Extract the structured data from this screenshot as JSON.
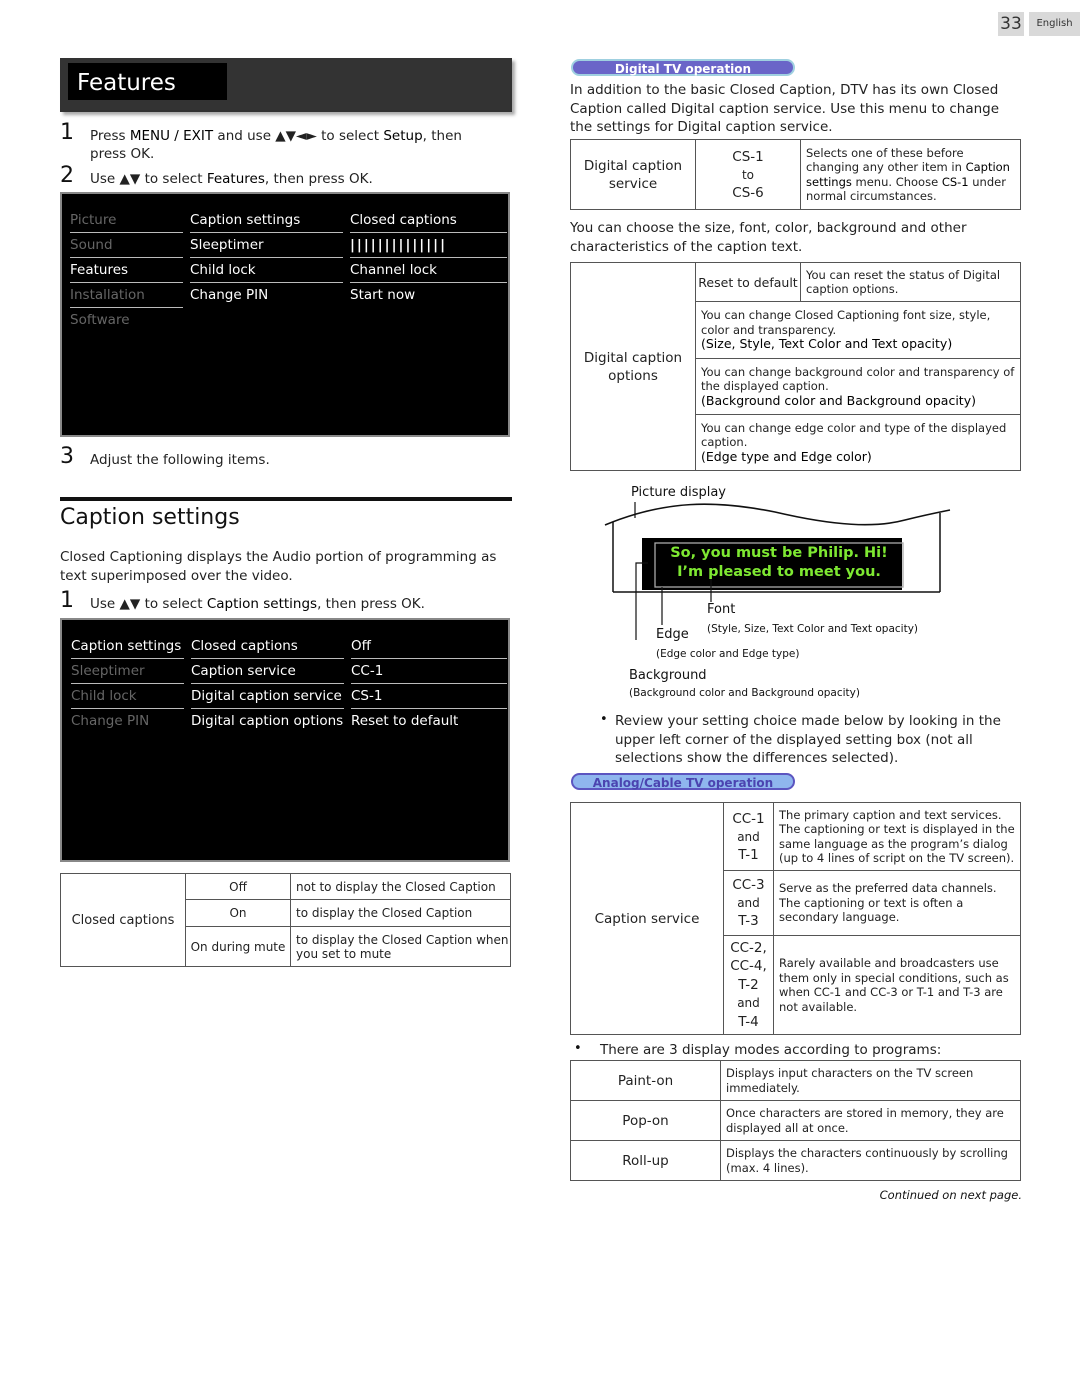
{
  "page": {
    "number": "33",
    "language": "English"
  },
  "left": {
    "banner_title": "Features",
    "steps": [
      {
        "num": "1",
        "pre": "Press ",
        "b1": "MENU / EXIT",
        "mid": " and use ▲▼◄► to select ",
        "b2": "Setup",
        "post": ", then press OK."
      },
      {
        "num": "2",
        "pre": "Use ▲▼ to select ",
        "b1": "Features",
        "post": ", then press OK."
      },
      {
        "num": "3",
        "text": "Adjust the following items."
      }
    ],
    "menu1": {
      "col1": [
        "Picture",
        "Sound",
        "Features",
        "Installation",
        "Software"
      ],
      "col1_active_index": 2,
      "col2": [
        "Caption settings",
        "Sleeptimer",
        "Child lock",
        "Change PIN"
      ],
      "col3": [
        "Closed captions",
        "||||||||||||||",
        "Channel lock",
        "Start now"
      ]
    },
    "section_title": "Caption settings",
    "section_intro": "Closed Captioning displays the Audio portion of programming as text superimposed over the video.",
    "section_step": {
      "num": "1",
      "pre": "Use ▲▼ to select ",
      "b1": "Caption settings",
      "post": ", then press OK."
    },
    "menu2": {
      "col1": [
        "Caption settings",
        "Sleeptimer",
        "Child lock",
        "Change PIN"
      ],
      "col2": [
        "Closed captions",
        "Caption service",
        "Digital caption service",
        "Digital caption options"
      ],
      "col3": [
        "Off",
        "CC-1",
        "CS-1",
        "Reset to default"
      ]
    },
    "cc_table": {
      "label": "Closed captions",
      "rows": [
        {
          "option": "Off",
          "desc": "not to display the Closed Caption"
        },
        {
          "option": "On",
          "desc": "to display the Closed Caption"
        },
        {
          "option": "On during mute",
          "desc": "to display the Closed Caption when you set to mute"
        }
      ]
    }
  },
  "right": {
    "digital_pill": "Digital TV operation",
    "digital_intro": "In addition to the basic Closed Caption, DTV has its own Closed Caption called Digital caption service. Use this menu to change the settings for Digital caption service.",
    "dcs_table": {
      "label": "Digital caption service",
      "range_from": "CS-1",
      "range_to_word": "to",
      "range_to": "CS-6",
      "desc_pre": "Selects one of these before changing any other item in ",
      "desc_b1": "Caption settings",
      "desc_mid": " menu. Choose ",
      "desc_b2": "CS-1",
      "desc_post": " under normal circumstances."
    },
    "options_intro": "You can choose the size, font, color, background and other characteristics of the caption text.",
    "dco_table": {
      "label": "Digital caption options",
      "reset_label": "Reset to default",
      "reset_desc": "You can reset the status of Digital caption options.",
      "rows": [
        {
          "desc": "You can change Closed Captioning font size, style, color and transparency.",
          "detail": "(Size, Style, Text Color and Text opacity)"
        },
        {
          "desc": "You can change background color and transparency of the displayed caption.",
          "detail": "(Background color and Background opacity)"
        },
        {
          "desc": "You can change edge color and type of the displayed caption.",
          "detail": "(Edge type and Edge color)"
        }
      ]
    },
    "diagram": {
      "picture_display": "Picture display",
      "caption_line1": "So, you must be Philip. Hi!",
      "caption_line2": "I’m pleased to meet you.",
      "font_label": "Font",
      "font_sub": "(Style, Size, Text Color and Text opacity)",
      "edge_label": "Edge",
      "edge_sub": "(Edge color and Edge type)",
      "background_label": "Background",
      "background_sub": "(Background color and Background opacity)",
      "caption_color": "#7ee832"
    },
    "review_bullet": "Review your setting choice made below by looking in the upper left corner of the displayed setting box (not all selections show the differences selected).",
    "analog_pill": "Analog/Cable TV operation",
    "cs_table": {
      "label": "Caption service",
      "rows": [
        {
          "codes": [
            "CC-1",
            "and",
            "T-1"
          ],
          "desc": "The primary caption and text services. The captioning or text is displayed in the same language as the program’s dialog (up to 4 lines of script on the TV screen)."
        },
        {
          "codes": [
            "CC-3",
            "and",
            "T-3"
          ],
          "desc": "Serve as the preferred data channels. The captioning or text is often a secondary language."
        },
        {
          "codes": [
            "CC-2,",
            "CC-4,",
            "T-2",
            "and",
            "T-4"
          ],
          "desc": "Rarely available and broadcasters use them only in special conditions, such as when CC-1 and CC-3 or T-1 and T-3 are not available."
        }
      ]
    },
    "modes_bullet": "There are 3 display modes according to programs:",
    "modes_table": [
      {
        "mode": "Paint-on",
        "desc": "Displays input characters on the TV screen immediately."
      },
      {
        "mode": "Pop-on",
        "desc": "Once characters are stored in memory, they are displayed all at once."
      },
      {
        "mode": "Roll-up",
        "desc": "Displays the characters continuously by scrolling (max. 4 lines)."
      }
    ],
    "continued": "Continued on next page."
  }
}
